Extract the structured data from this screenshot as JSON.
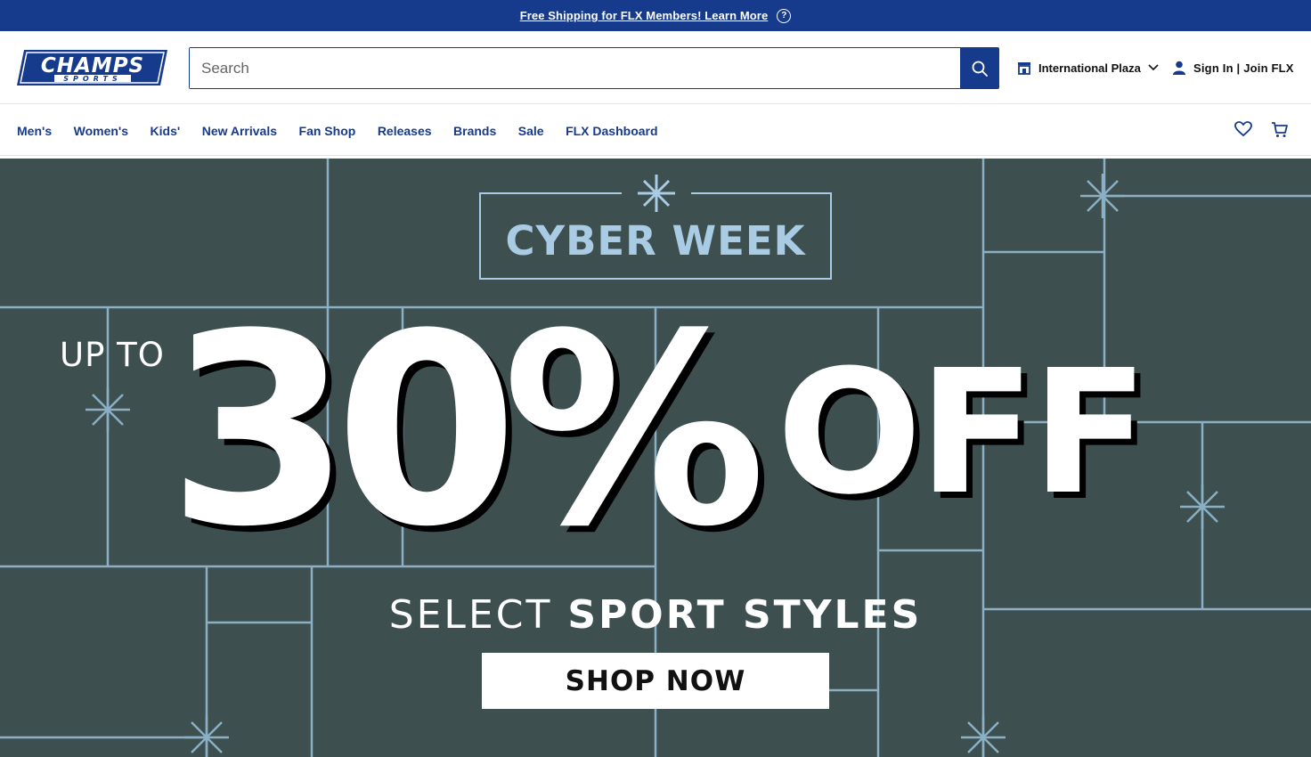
{
  "promo_bar": {
    "text": "Free Shipping for FLX Members! Learn More",
    "help_glyph": "?",
    "background": "#173b8c"
  },
  "header": {
    "logo": {
      "main": "CHAMPS",
      "sub": "SPORTS"
    },
    "search": {
      "placeholder": "Search",
      "value": ""
    },
    "store": {
      "label": "International Plaza"
    },
    "account": {
      "label": "Sign In | Join FLX"
    }
  },
  "nav": {
    "items": [
      "Men's",
      "Women's",
      "Kids'",
      "New Arrivals",
      "Fan Shop",
      "Releases",
      "Brands",
      "Sale",
      "FLX Dashboard"
    ],
    "icons": [
      "heart-icon",
      "cart-icon"
    ]
  },
  "hero": {
    "eyebrow": "CYBER WEEK",
    "up_to": "UP TO",
    "amount": "30%",
    "off": "OFF",
    "select_light": "SELECT",
    "select_bold": "SPORT STYLES",
    "cta": "SHOP NOW",
    "background": "#3e4f4f",
    "line_color": "#8bb0c6",
    "accent": "#a9cbe4"
  }
}
